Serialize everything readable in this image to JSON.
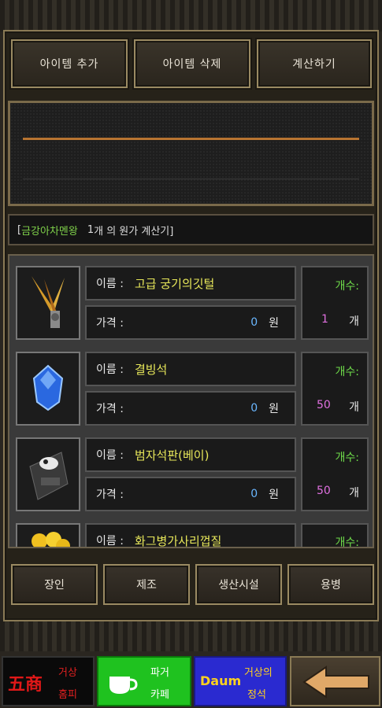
{
  "toolbar": {
    "add": "아이템 추가",
    "delete": "아이템 삭제",
    "calc": "계산하기"
  },
  "info": {
    "prefix": "[ ",
    "location": "금강아차멘왕",
    "count": "1",
    "suffix": " 개 의 원가 계산기]"
  },
  "labels": {
    "name": "이름 :",
    "price": "가격 :",
    "count": "개수:",
    "won": "원",
    "unit": "개"
  },
  "items": [
    {
      "name": "고급 궁기의깃털",
      "price": "0",
      "count": "1",
      "icon": "feather-icon"
    },
    {
      "name": "결빙석",
      "price": "0",
      "count": "50",
      "icon": "blue-gem-icon"
    },
    {
      "name": "범자석판(베이)",
      "price": "0",
      "count": "50",
      "icon": "stone-tablet-icon"
    },
    {
      "name": "화그병가사리껍질",
      "price": "",
      "count": "",
      "icon": "yellow-flower-icon"
    }
  ],
  "tabs": [
    "장인",
    "제조",
    "생산시설",
    "용병"
  ],
  "ads": {
    "a1_logo": "五商",
    "a1_t1": "거상",
    "a1_t2": "홈피",
    "a2_t1": "파거",
    "a2_t2": "카페",
    "a3_logo": "Daum",
    "a3_t1": "거상의",
    "a3_t2": "정석"
  },
  "colors": {
    "accent_line": "#b87431",
    "name_text": "#e8e85a",
    "count_label": "#6fdc4a",
    "count_value": "#e070e0",
    "price_value": "#6ab7ff"
  }
}
